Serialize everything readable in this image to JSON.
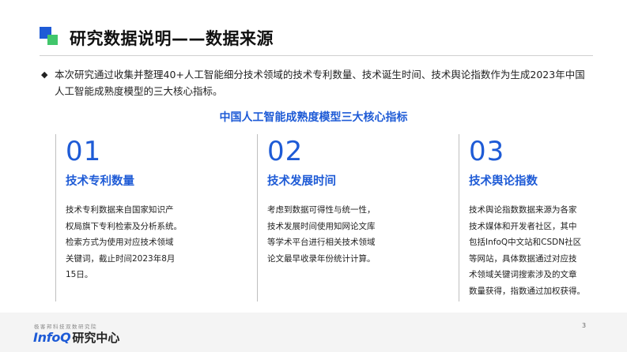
{
  "header": {
    "title": "研究数据说明——数据来源"
  },
  "intro": {
    "bullet_glyph": "◆",
    "text": "本次研究通过收集并整理40+人工智能细分技术领域的技术专利数量、技术诞生时间、技术舆论指数作为生成2023年中国人工智能成熟度模型的三大核心指标。"
  },
  "subheading": "中国人工智能成熟度模型三大核心指标",
  "cards": [
    {
      "number": "01",
      "title": "技术专利数量",
      "body_lines": [
        "技术专利数据来自国家知识产",
        "权局旗下专利检索及分析系统。",
        "检索方式为使用对应技术领域",
        "关键词，截止时间2023年8月",
        "15日。"
      ]
    },
    {
      "number": "02",
      "title": "技术发展时间",
      "body_lines": [
        "考虑到数据可得性与统一性，",
        "技术发展时间使用知网论文库",
        "等学术平台进行相关技术领域",
        "论文最早收录年份统计计算。"
      ]
    },
    {
      "number": "03",
      "title": "技术舆论指数",
      "body_lines": [
        "技术舆论指数数据来源为各家",
        "技术媒体和开发者社区，其中",
        "包括InfoQ中文站和CSDN社区",
        "等网站，具体数据通过对应技",
        "术领域关键词搜索涉及的文章",
        "数量获得，指数通过加权获得。"
      ]
    }
  ],
  "footer": {
    "tagline": "极客邦科技双数研究院",
    "brand_en": "InfoQ",
    "brand_cn": "研究中心",
    "page_number": "3"
  },
  "colors": {
    "accent_blue": "#1e5bd6",
    "accent_green": "#41c66b"
  }
}
